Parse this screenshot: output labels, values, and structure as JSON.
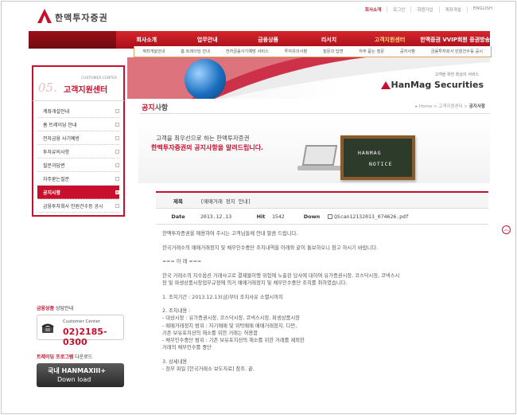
{
  "header": {
    "logo_text": "한맥투자증권",
    "util_links": [
      "회사소개",
      "로그인",
      "회원가입",
      "계좌개설",
      "ENGLISH"
    ]
  },
  "nav": {
    "items": [
      "회사소개",
      "업무안내",
      "금융상품",
      "리서치",
      "고객지원센터",
      "한맥증권 VVIP회원 증권방송"
    ],
    "active_index": 4,
    "sub_items": [
      "계좌개설안내",
      "홈 트레이딩 안내",
      "전자금융사기예방 서비스",
      "투자유의사항",
      "질문과 답변",
      "자주 묻는 질문",
      "공지사항",
      "금융투자회사 민원건수등 공시"
    ]
  },
  "side_banner": {
    "customer_center": "CUSTOMER CENTER",
    "number": "05.",
    "title": "고객지원센터"
  },
  "sidebar": {
    "items": [
      {
        "label": "계좌개설안내"
      },
      {
        "label": "홈 트레이딩 안내"
      },
      {
        "label": "전자금융 사기예방"
      },
      {
        "label": "투자유의사항"
      },
      {
        "label": "질문과답변"
      },
      {
        "label": "자주묻는질문"
      },
      {
        "label": "공지사항"
      },
      {
        "label": "금융투자회사 민원건수등 공시"
      }
    ],
    "active_index": 6
  },
  "hero": {
    "tagline": "고객을 위한 최상의 서비스",
    "brand": "HanMag Securities"
  },
  "page": {
    "title_bold": "공지",
    "title_rest": "사항",
    "breadcrumb_home": "Home",
    "breadcrumb_mid": "고객지원센터",
    "breadcrumb_current": "공지사항"
  },
  "notice_banner": {
    "line1": "고객을 최우선으로 하는 한맥투자증권",
    "line2": "한맥투자증권의 공지사항을 알려드립니다.",
    "board_line1": "HANMAG",
    "board_line2": "NOTICE"
  },
  "post": {
    "subject_label": "제목",
    "subject": "[매매거래 정지 안내]",
    "date_label": "Date",
    "date": "2013.12.13",
    "hit_label": "Hit",
    "hit": "1542",
    "down_label": "Down",
    "file": "QScan12132013_074626.pdf"
  },
  "content": {
    "lines": [
      "한맥투자증권을 애용하여 주시는 고객님들께 안내 말씀 드립니다.",
      "",
      "한국거래소의 매매거래정지 및 채무인수중단 조치내역을 아래와 같이 통보하오니 참고 하시기 바랍니다.",
      "",
      "=== 아 래 ===",
      "",
      "한국 거래소의 지수옵션 거래사고로 결제불이행 위험에 노출된 당사에 대하여 유가증권시장, 코스닥시장, 코넥스시",
      "장 및 파생상품시장업무규정에 의거 매매거래정지 및 채무인수중단 조치를 취하였습니다.",
      "",
      "1. 조치기간 : 2013.12.13(금)부터 조치사유 소멸시까지",
      "",
      "2. 조치내용 :",
      "- 대상시장 : 유가증권시장, 코스닥시장, 코넥스시장, 파생상품시장",
      "- 매매거래정지 범위 : 자기매매 및 위탁매매 매매거래정지. 다만,",
      "기존 보유포지션의 해소를 위한 거래는 허용함",
      "- 채무인수중단 범위 : 기존 보유포지션의 해소를 위한 거래를 제외한",
      "거래의 채무인수를 중단",
      "",
      "3. 상세내용",
      "- 첨부 파일 [한국거래소 보도자료] 참조. 끝."
    ]
  },
  "customer_center": {
    "head_bold": "금융상품",
    "head_rest": "상담안내",
    "label": "Customer Center",
    "phone": "02)2185-0300"
  },
  "trading_program": {
    "head_bold": "트레이딩 프로그램",
    "head_rest": "다운로드",
    "line1": "국내 HANMAXIII+",
    "line2": "Down load"
  },
  "colors": {
    "brand_red": "#c8102e",
    "board_green": "#2d3b2a"
  },
  "icons": [
    "logo-triangle-icon",
    "phone-icon",
    "scroll-top-icon",
    "attachment-icon"
  ]
}
